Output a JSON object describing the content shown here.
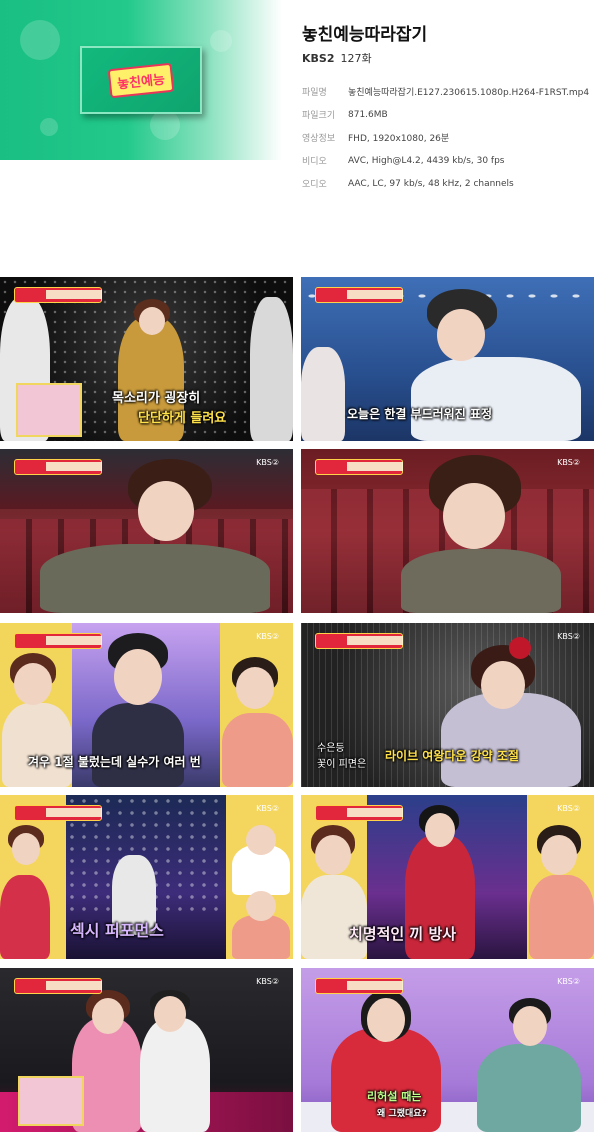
{
  "header": {
    "title": "놓친예능따라잡기",
    "channel": "KBS2",
    "episode": "127화",
    "cover_logo": "놓친예능",
    "meta": [
      {
        "label": "파일명",
        "value": "놓친예능따라잡기.E127.230615.1080p.H264-F1RST.mp4"
      },
      {
        "label": "파일크기",
        "value": "871.6MB"
      },
      {
        "label": "영상정보",
        "value": "FHD, 1920x1080, 26분"
      },
      {
        "label": "비디오",
        "value": "AVC, High@L4.2, 4439 kb/s, 30 fps"
      },
      {
        "label": "오디오",
        "value": "AAC, LC, 97 kb/s, 48 kHz, 2 channels"
      }
    ]
  },
  "captions": {
    "s1a": "목소리가 굉장히",
    "s1b": "단단하게 들려요",
    "s2": "오늘은 한결 부드러워진 표정",
    "s5": "겨우 1절 불렀는데 실수가 여러 번",
    "s6a": "수은등",
    "s6b": "꽃이 피면은",
    "s6c": "라이브 여왕다운 강약 조절",
    "s7": "섹시 퍼포먼스",
    "s8": "치명적인 끼 방사",
    "s10a": "리허설 때는",
    "s10b": "왜 그랬대요?"
  },
  "watermark": "KBS②",
  "colors": {
    "accent_red": "#e2273d",
    "cover_green": "#19bf83",
    "caption_yellow": "#ffe14a"
  }
}
